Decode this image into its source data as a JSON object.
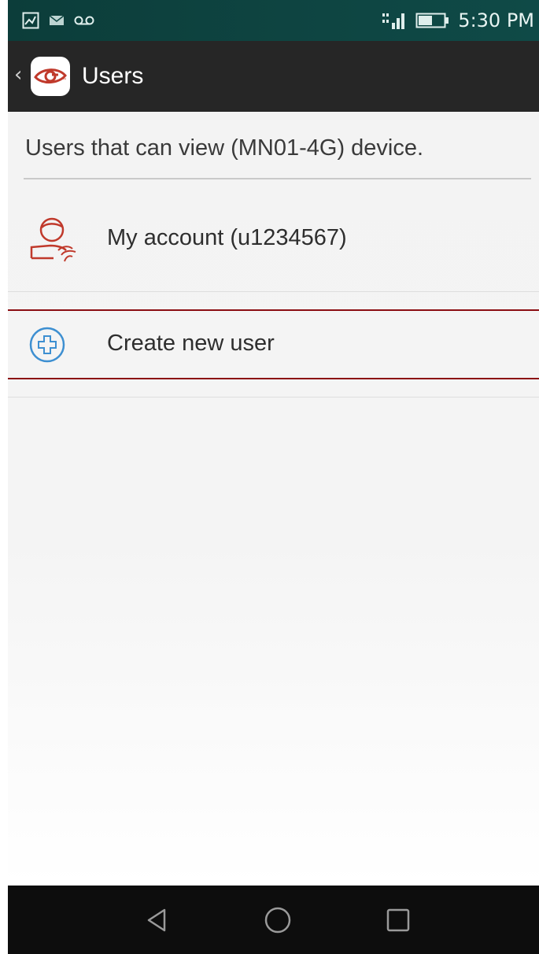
{
  "status_bar": {
    "time": "5:30 PM",
    "left_icons": [
      "image-icon",
      "mail-icon",
      "voicemail-icon"
    ],
    "right_icons": [
      "signal-icon",
      "battery-icon"
    ]
  },
  "app_bar": {
    "title": "Users",
    "back_icon": "back-chevron-icon",
    "logo_icon": "eye-logo-icon",
    "background": "#262626"
  },
  "content": {
    "subtitle": "Users that can view (MN01-4G) device.",
    "users": [
      {
        "label": "My account (u1234567)",
        "icon": "user-avatar-icon"
      }
    ],
    "create_user": {
      "label": "Create new user",
      "icon": "add-circle-icon"
    }
  },
  "nav_bar": {
    "buttons": [
      "back-triangle-icon",
      "home-circle-icon",
      "recent-apps-square-icon"
    ]
  },
  "colors": {
    "accent_red": "#c0392b",
    "highlight_border": "#8b0d12",
    "add_icon_blue": "#3d8fd1"
  }
}
